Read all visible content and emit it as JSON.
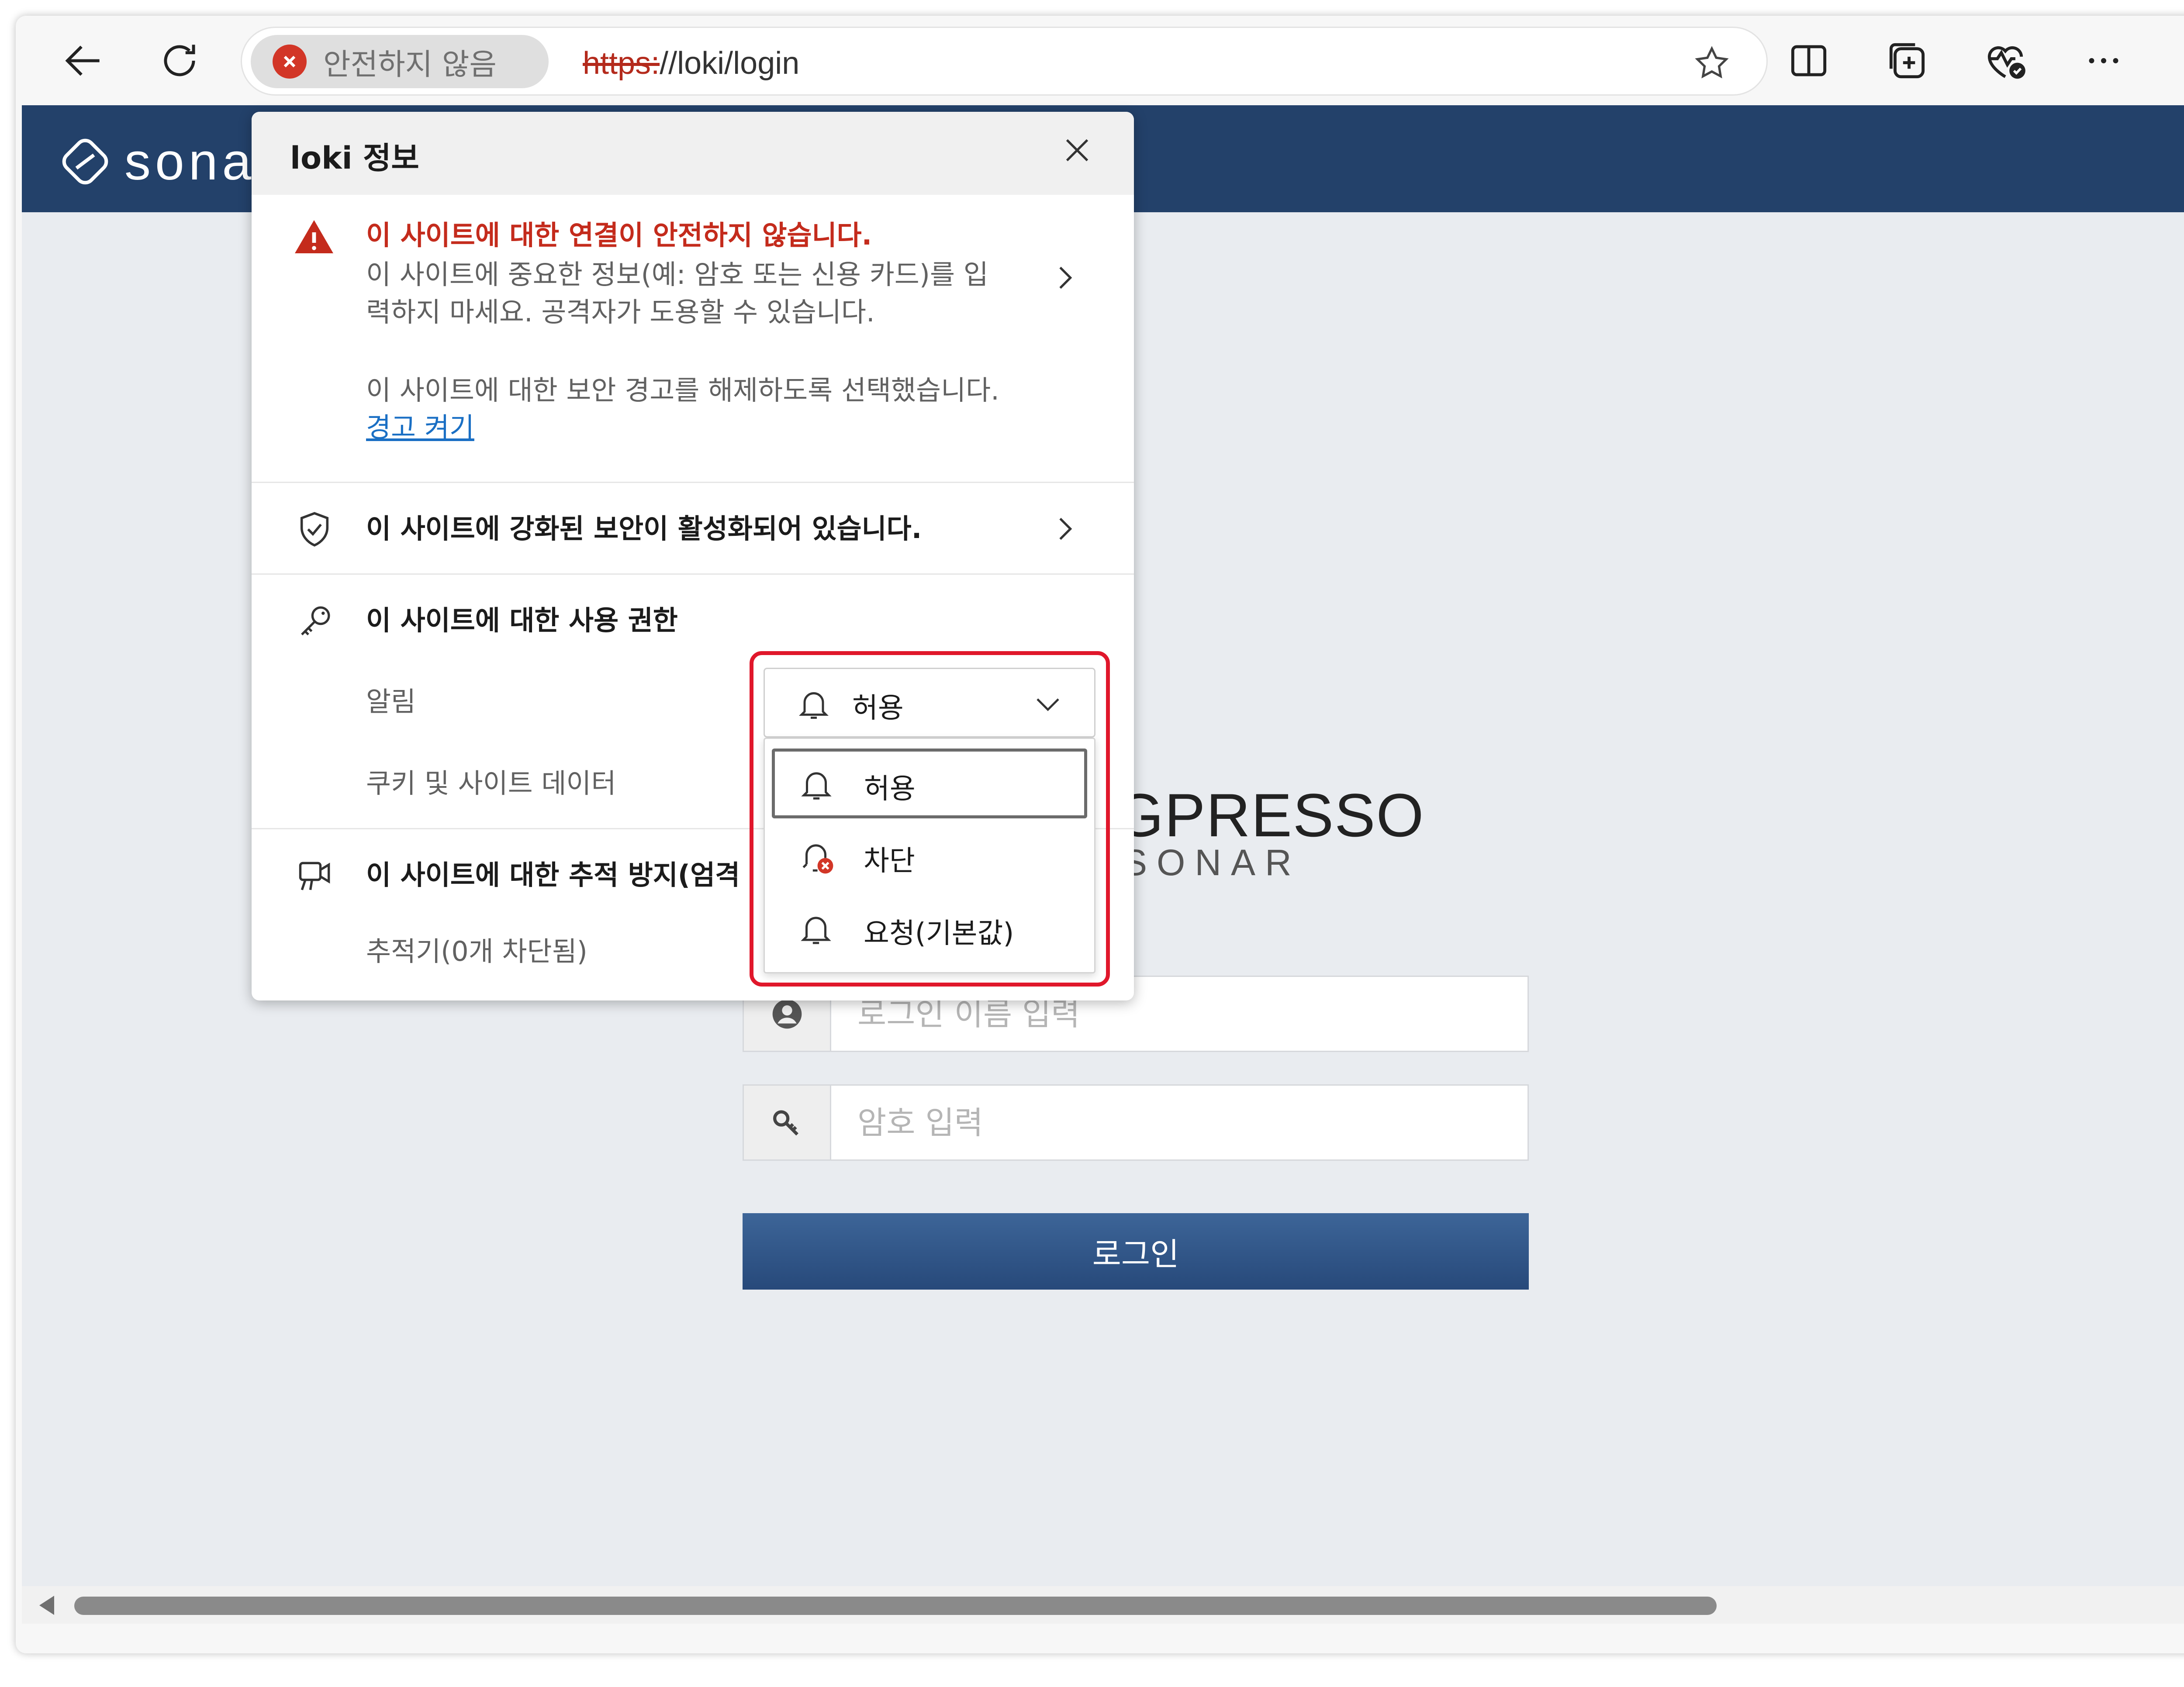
{
  "browser": {
    "security_chip_label": "안전하지 않음",
    "url_scheme": "https:",
    "url_rest": "//loki/login"
  },
  "page": {
    "logo_text": "sona",
    "brand_main": "GPRESSO",
    "brand_sub": "SONAR",
    "username_placeholder": "로그인 이름 입력",
    "password_placeholder": "암호 입력",
    "login_button": "로그인"
  },
  "popup": {
    "title": "loki 정보",
    "warning_title": "이 사이트에 대한 연결이 안전하지 않습니다.",
    "warning_desc_line1": "이 사이트에 중요한 정보(예: 암호 또는 신용 카드)를 입",
    "warning_desc_line2": "력하지 마세요. 공격자가 도용할 수 있습니다.",
    "dismissed_text": "이 사이트에 대한 보안 경고를 해제하도록 선택했습니다.",
    "turn_on_warnings_link": "경고 켜기",
    "enhanced_security": "이 사이트에 강화된 보안이 활성화되어 있습니다.",
    "permissions_title": "이 사이트에 대한 사용 권한",
    "notifications_label": "알림",
    "cookies_label": "쿠키 및 사이트 데이터",
    "tracking_title": "이 사이트에 대한 추적 방지(엄격",
    "trackers_label": "추적기(0개 차단됨)"
  },
  "dropdown": {
    "selected_value": "허용",
    "options": [
      "허용",
      "차단",
      "요청(기본값)"
    ]
  }
}
